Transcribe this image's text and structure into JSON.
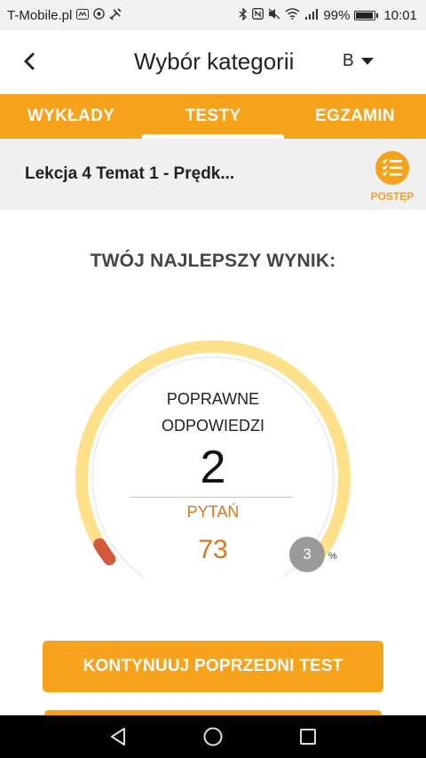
{
  "status_bar": {
    "carrier": "T-Mobile.pl",
    "battery_text": "99%",
    "battery_level": 0.99,
    "time": "10:01",
    "left_icons": [
      "message-icon",
      "chrome-icon",
      "tools-icon"
    ],
    "right_icons": [
      "bluetooth-icon",
      "nfc-icon",
      "mute-icon",
      "wifi-icon",
      "signal-icon"
    ]
  },
  "app_bar": {
    "title": "Wybór kategorii",
    "category": "B"
  },
  "tabs": [
    {
      "label": "WYKŁADY",
      "active": false
    },
    {
      "label": "TESTY",
      "active": true
    },
    {
      "label": "EGZAMIN",
      "active": false
    }
  ],
  "lesson": {
    "title": "Lekcja 4 Temat 1 - Prędk...",
    "progress_label": "POSTĘP"
  },
  "score": {
    "heading": "TWÓJ NAJLEPSZY WYNIK:",
    "correct_label_1": "POPRAWNE",
    "correct_label_2": "ODPOWIEDZI",
    "correct_value": "2",
    "questions_label": "PYTAŃ",
    "questions_value": "73",
    "percent_value": "3",
    "percent_sign": "%",
    "percent_fraction": 0.03
  },
  "buttons": {
    "continue_label": "KONTYNUUJ POPRZEDNI TEST"
  },
  "colors": {
    "accent": "#f7a21b",
    "gauge_track": "#fde08a",
    "gauge_fill": "#d4593a",
    "questions_text": "#d9761e"
  }
}
